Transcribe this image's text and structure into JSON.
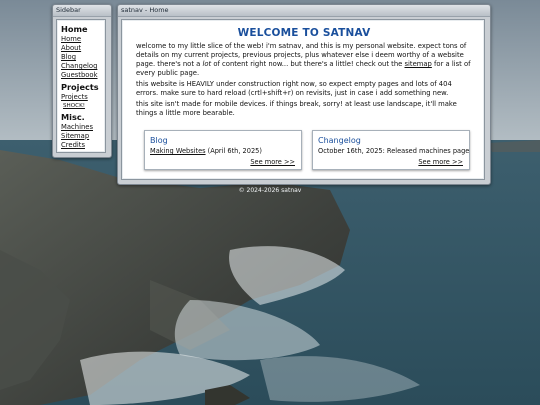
{
  "sidebar": {
    "title": "Sidebar",
    "home_heading": "Home",
    "home_links": [
      "Home",
      "About",
      "Blog",
      "Changelog",
      "Guestbook"
    ],
    "projects_heading": "Projects",
    "projects_link": "Projects",
    "shock_label": "SHOCK!",
    "misc_heading": "Misc.",
    "misc_links": [
      "Machines",
      "Sitemap",
      "Credits"
    ]
  },
  "main": {
    "title": "satnav - Home",
    "welcome": "WELCOME TO SATNAV",
    "p1_start": "welcome to my little slice of the web! i'm satnav, and this is my personal website. expect tons of details on my current projects, previous projects, plus whatever else i deem worthy of a website page. there's not a ",
    "p1_em": "lot",
    "p1_mid": " of content right now... but there's a little! check out the ",
    "p1_link": "sitemap",
    "p1_end": " for a list of every public page.",
    "p2": "this website is HEAVILY under construction right now, so expect empty pages and lots of 404 errors. make sure to hard reload (crtl+shift+r) on revisits, just in case i add something new.",
    "p3": "this site isn't made for mobile devices. if things break, sorry! at least use landscape, it'll make things a little more bearable."
  },
  "cards": {
    "blog": {
      "title": "Blog",
      "link": "Making Websites",
      "date": " (April 6th, 2025)",
      "more": "See more >>"
    },
    "changelog": {
      "title": "Changelog",
      "entry": "October 16th, 2025: Released machines page",
      "more": "See more >>"
    }
  },
  "footer": "© 2024-2026 satnav"
}
